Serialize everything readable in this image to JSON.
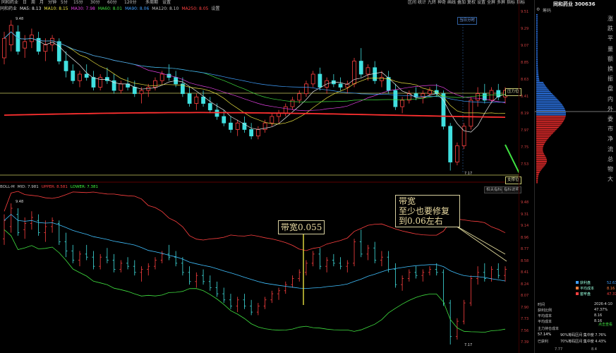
{
  "toolbar": {
    "left_items": [
      "同和药业",
      "日",
      "周",
      "月",
      "分钟",
      "5分",
      "15分",
      "30分",
      "60分",
      "120分",
      "多周期",
      "设置"
    ],
    "right_items": [
      "区间",
      "统计",
      "九转",
      "神奇",
      "画线",
      "叠加",
      "复权",
      "设置",
      "全屏",
      "多屏",
      "指标",
      "指标"
    ]
  },
  "ma_row": {
    "name": "同和药业",
    "items": [
      {
        "label": "MA5: 8.13",
        "color": "#e8e8e8"
      },
      {
        "label": "MA10: 8.15",
        "color": "#e8e040"
      },
      {
        "label": "MA30: 7.98",
        "color": "#e040e0"
      },
      {
        "label": "MA60: 8.01",
        "color": "#40e040"
      },
      {
        "label": "MA90: 8.06",
        "color": "#40a0ff"
      },
      {
        "label": "MA120: 8.10",
        "color": "#c0c0c0"
      },
      {
        "label": "MA250: 8.05",
        "color": "#ff4040"
      },
      {
        "label": "设置",
        "color": "#c8c8c8"
      }
    ]
  },
  "price_chart": {
    "high_label": "9.48",
    "low_label": "7.17",
    "today_tag": "当日分时",
    "pressure_label": "压力位",
    "support_label": "支撑位",
    "candles": [
      {
        "o": 8.9,
        "h": 9.3,
        "l": 8.8,
        "c": 9.2
      },
      {
        "o": 9.1,
        "h": 9.48,
        "l": 9.0,
        "c": 9.4
      },
      {
        "o": 9.3,
        "h": 9.4,
        "l": 8.95,
        "c": 9.0
      },
      {
        "o": 9.05,
        "h": 9.25,
        "l": 8.9,
        "c": 9.15
      },
      {
        "o": 9.15,
        "h": 9.35,
        "l": 9.05,
        "c": 9.25
      },
      {
        "o": 9.2,
        "h": 9.3,
        "l": 8.95,
        "c": 9.0
      },
      {
        "o": 9.0,
        "h": 9.2,
        "l": 8.85,
        "c": 9.1
      },
      {
        "o": 9.1,
        "h": 9.25,
        "l": 9.0,
        "c": 9.2
      },
      {
        "o": 9.15,
        "h": 9.2,
        "l": 8.8,
        "c": 8.85
      },
      {
        "o": 8.85,
        "h": 9.0,
        "l": 8.6,
        "c": 8.7
      },
      {
        "o": 8.7,
        "h": 8.8,
        "l": 8.5,
        "c": 8.55
      },
      {
        "o": 8.55,
        "h": 8.7,
        "l": 8.45,
        "c": 8.65
      },
      {
        "o": 8.65,
        "h": 8.8,
        "l": 8.55,
        "c": 8.6
      },
      {
        "o": 8.6,
        "h": 8.7,
        "l": 8.4,
        "c": 8.45
      },
      {
        "o": 8.45,
        "h": 8.65,
        "l": 8.4,
        "c": 8.6
      },
      {
        "o": 8.6,
        "h": 8.75,
        "l": 8.5,
        "c": 8.55
      },
      {
        "o": 8.55,
        "h": 8.65,
        "l": 8.35,
        "c": 8.4
      },
      {
        "o": 8.4,
        "h": 8.55,
        "l": 8.35,
        "c": 8.5
      },
      {
        "o": 8.5,
        "h": 8.6,
        "l": 8.4,
        "c": 8.45
      },
      {
        "o": 8.45,
        "h": 8.55,
        "l": 8.3,
        "c": 8.35
      },
      {
        "o": 8.35,
        "h": 8.45,
        "l": 8.2,
        "c": 8.4
      },
      {
        "o": 8.4,
        "h": 8.5,
        "l": 8.3,
        "c": 8.45
      },
      {
        "o": 8.45,
        "h": 8.6,
        "l": 8.4,
        "c": 8.55
      },
      {
        "o": 8.55,
        "h": 8.7,
        "l": 8.5,
        "c": 8.65
      },
      {
        "o": 8.65,
        "h": 8.8,
        "l": 8.55,
        "c": 8.6
      },
      {
        "o": 8.6,
        "h": 8.7,
        "l": 8.45,
        "c": 8.5
      },
      {
        "o": 8.5,
        "h": 8.6,
        "l": 8.3,
        "c": 8.35
      },
      {
        "o": 8.35,
        "h": 8.45,
        "l": 8.15,
        "c": 8.2
      },
      {
        "o": 8.2,
        "h": 8.35,
        "l": 8.1,
        "c": 8.3
      },
      {
        "o": 8.3,
        "h": 8.4,
        "l": 8.15,
        "c": 8.2
      },
      {
        "o": 8.2,
        "h": 8.3,
        "l": 8.05,
        "c": 8.1
      },
      {
        "o": 8.1,
        "h": 8.2,
        "l": 7.95,
        "c": 8.0
      },
      {
        "o": 8.0,
        "h": 8.1,
        "l": 7.85,
        "c": 7.9
      },
      {
        "o": 7.9,
        "h": 8.0,
        "l": 7.75,
        "c": 7.8
      },
      {
        "o": 7.8,
        "h": 7.95,
        "l": 7.7,
        "c": 7.9
      },
      {
        "o": 7.9,
        "h": 8.0,
        "l": 7.75,
        "c": 7.8
      },
      {
        "o": 7.8,
        "h": 7.9,
        "l": 7.65,
        "c": 7.7
      },
      {
        "o": 7.7,
        "h": 7.85,
        "l": 7.65,
        "c": 7.8
      },
      {
        "o": 7.8,
        "h": 7.95,
        "l": 7.75,
        "c": 7.9
      },
      {
        "o": 7.9,
        "h": 8.05,
        "l": 7.85,
        "c": 8.0
      },
      {
        "o": 8.0,
        "h": 8.1,
        "l": 7.9,
        "c": 8.05
      },
      {
        "o": 8.05,
        "h": 8.2,
        "l": 8.0,
        "c": 8.15
      },
      {
        "o": 8.15,
        "h": 8.3,
        "l": 8.1,
        "c": 8.25
      },
      {
        "o": 8.25,
        "h": 8.4,
        "l": 8.2,
        "c": 8.35
      },
      {
        "o": 8.35,
        "h": 8.55,
        "l": 8.3,
        "c": 8.5
      },
      {
        "o": 8.5,
        "h": 8.7,
        "l": 8.45,
        "c": 8.65
      },
      {
        "o": 8.65,
        "h": 8.75,
        "l": 8.4,
        "c": 8.45
      },
      {
        "o": 8.45,
        "h": 8.6,
        "l": 8.35,
        "c": 8.55
      },
      {
        "o": 8.55,
        "h": 8.65,
        "l": 8.45,
        "c": 8.5
      },
      {
        "o": 8.5,
        "h": 8.6,
        "l": 8.4,
        "c": 8.45
      },
      {
        "o": 8.45,
        "h": 8.55,
        "l": 8.35,
        "c": 8.5
      },
      {
        "o": 8.5,
        "h": 8.9,
        "l": 8.45,
        "c": 8.85
      },
      {
        "o": 8.85,
        "h": 9.05,
        "l": 8.6,
        "c": 8.65
      },
      {
        "o": 8.65,
        "h": 8.8,
        "l": 8.55,
        "c": 8.75
      },
      {
        "o": 8.75,
        "h": 8.85,
        "l": 8.5,
        "c": 8.55
      },
      {
        "o": 8.55,
        "h": 8.7,
        "l": 8.45,
        "c": 8.6
      },
      {
        "o": 8.6,
        "h": 8.7,
        "l": 8.35,
        "c": 8.4
      },
      {
        "o": 8.4,
        "h": 8.5,
        "l": 8.1,
        "c": 8.15
      },
      {
        "o": 8.15,
        "h": 8.3,
        "l": 8.05,
        "c": 8.25
      },
      {
        "o": 8.25,
        "h": 8.4,
        "l": 8.2,
        "c": 8.35
      },
      {
        "o": 8.35,
        "h": 8.45,
        "l": 8.25,
        "c": 8.3
      },
      {
        "o": 8.3,
        "h": 8.4,
        "l": 8.2,
        "c": 8.35
      },
      {
        "o": 8.35,
        "h": 8.45,
        "l": 8.3,
        "c": 8.4
      },
      {
        "o": 8.4,
        "h": 8.5,
        "l": 8.3,
        "c": 8.35
      },
      {
        "o": 8.35,
        "h": 8.4,
        "l": 7.8,
        "c": 7.85
      },
      {
        "o": 7.85,
        "h": 7.9,
        "l": 7.17,
        "c": 7.3
      },
      {
        "o": 7.3,
        "h": 7.6,
        "l": 7.25,
        "c": 7.55
      },
      {
        "o": 7.55,
        "h": 7.9,
        "l": 7.5,
        "c": 7.85
      },
      {
        "o": 7.85,
        "h": 8.3,
        "l": 7.8,
        "c": 8.25
      },
      {
        "o": 8.25,
        "h": 8.45,
        "l": 8.15,
        "c": 8.35
      },
      {
        "o": 8.35,
        "h": 8.5,
        "l": 8.2,
        "c": 8.25
      },
      {
        "o": 8.25,
        "h": 8.45,
        "l": 8.2,
        "c": 8.4
      },
      {
        "o": 8.4,
        "h": 8.5,
        "l": 8.25,
        "c": 8.3
      },
      {
        "o": 8.3,
        "h": 8.45,
        "l": 8.2,
        "c": 8.4
      }
    ]
  },
  "bollinger": {
    "header": [
      {
        "label": "BOLL-M",
        "color": "#c8c8c8"
      },
      {
        "label": "MID: 7.981",
        "color": "#c8c8c8"
      },
      {
        "label": "UPPER: 8.581",
        "color": "#ff4040"
      },
      {
        "label": "LOWER: 7.381",
        "color": "#40ff40"
      }
    ],
    "high_label": "9.48",
    "low_label": "7.17",
    "buttons": [
      "相关指标",
      "指标说明"
    ]
  },
  "annotations": [
    {
      "lines": [
        "带宽0.055"
      ]
    },
    {
      "lines": [
        "带宽",
        "至少也要修复",
        "到0.06左右"
      ]
    }
  ],
  "axis": {
    "upper": [
      "9.51",
      "9.29",
      "9.07",
      "8.85",
      "8.63",
      "8.41",
      "8.19",
      "7.97",
      "7.75",
      "7.53"
    ],
    "lower": [
      "9.48",
      "9.31",
      "9.14",
      "8.96",
      "8.77",
      "8.58",
      "8.41",
      "8.24",
      "8.07",
      "7.90",
      "7.73",
      "7.56",
      "7.39"
    ]
  },
  "side": {
    "title": "同和药业 300636",
    "subtitle": "筹码",
    "categories": [
      "涨",
      "跌",
      "平",
      "量",
      "额",
      "换",
      "振",
      "盘",
      "内",
      "外",
      "委",
      "市",
      "净",
      "流",
      "总",
      "物",
      "大"
    ],
    "legend": [
      {
        "label": "获利盘",
        "value": "52.63%",
        "color": "#40a0ff"
      },
      {
        "label": "平均成本",
        "value": "8.16",
        "color": "#ff8040"
      },
      {
        "label": "套牢盘",
        "value": "47.37%",
        "color": "#ff4040"
      }
    ],
    "stats": [
      {
        "label": "时间",
        "value": "2026-4-10"
      },
      {
        "label": "获利比例",
        "value": "47.37%"
      },
      {
        "label": "平均成本",
        "value": "8.16"
      },
      {
        "label": "平均成本",
        "value": "8.16"
      }
    ],
    "concentration": [
      {
        "label": "主力持仓成本",
        "value": ""
      },
      {
        "label": "57.14%",
        "value": "90%筹码区间 集中度 7.76%"
      },
      {
        "label": "已获利",
        "value": "70%筹码区间 集中度 4.43%"
      }
    ],
    "bottom_axis": [
      "7.77",
      "8.4"
    ],
    "footer_label": "点击查看"
  }
}
